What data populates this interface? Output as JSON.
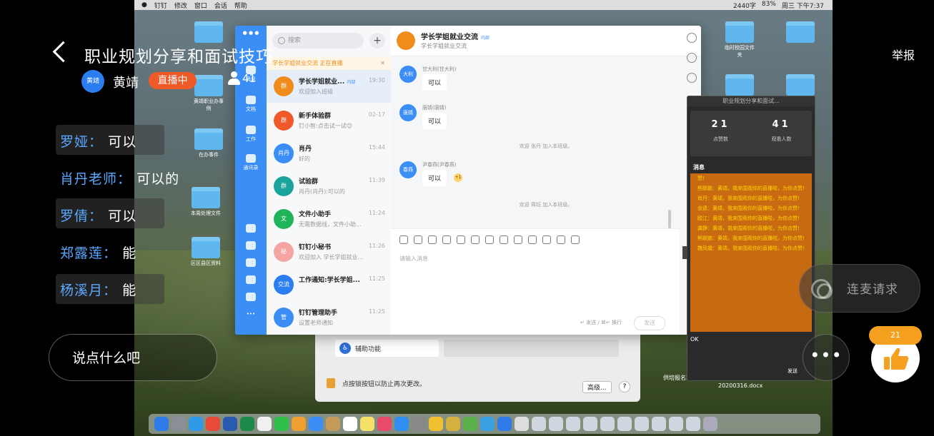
{
  "overlay": {
    "title": "职业规划分享和面试技巧",
    "host_name": "黄靖",
    "host_avatar_text": "黄靖",
    "live_badge": "直播中",
    "viewers": "41",
    "report": "举报",
    "comments": [
      {
        "who": "罗娅",
        "sep": "：",
        "text": "可以"
      },
      {
        "who": "肖丹老师",
        "sep": "：",
        "text": "可以的"
      },
      {
        "who": "罗倩",
        "sep": "：",
        "text": "可以"
      },
      {
        "who": "郑露莲",
        "sep": "：",
        "text": "能"
      },
      {
        "who": "杨溪月",
        "sep": "：",
        "text": "能"
      }
    ],
    "input_placeholder": "说点什么吧",
    "mic_label": "连麦请求",
    "more_label": "•••",
    "like_count": "21"
  },
  "mac": {
    "menus": [
      "钉钉",
      "修改",
      "窗口",
      "会话",
      "帮助"
    ],
    "status_right": [
      "2440字",
      "83%",
      "周三 下午7:37"
    ]
  },
  "desktop": {
    "folders": [
      {
        "label": "黄靖职业办事例"
      },
      {
        "label": "在办事件"
      },
      {
        "label": "本周处理文件"
      },
      {
        "label": "区区县区资料"
      },
      {
        "label": "临时校园文件夹"
      }
    ],
    "files": [
      "供培报名20200316.docx",
      "20200316.docx"
    ]
  },
  "dingtalk": {
    "rail": [
      {
        "label": "消息"
      },
      {
        "label": "文档"
      },
      {
        "label": "工作"
      },
      {
        "label": "通讯录"
      }
    ],
    "search_placeholder": "搜索",
    "live_banner": "学长学姐就业交流 正在直播",
    "conversations": [
      {
        "name": "学长学姐就业...",
        "tag": "内部",
        "preview": "欢迎加入班级",
        "time": "19:30",
        "color": "#f08c1c",
        "av": "群"
      },
      {
        "name": "新手体验群",
        "tag": "",
        "preview": "钉小智:点击试一试😊",
        "time": "02-17",
        "color": "#f05a28",
        "av": "群"
      },
      {
        "name": "肖丹",
        "tag": "",
        "preview": "好的",
        "time": "15:44",
        "color": "#3a8ef6",
        "av": "肖丹"
      },
      {
        "name": "试验群",
        "tag": "",
        "preview": "肖丹(肖丹):可以的",
        "time": "11:39",
        "color": "#1aa39a",
        "av": "群"
      },
      {
        "name": "文件小助手",
        "tag": "",
        "preview": "无需数据线，文件小助...",
        "time": "11:24",
        "color": "#20b45a",
        "av": "文"
      },
      {
        "name": "钉钉小秘书",
        "tag": "",
        "preview": "欢迎加入 学长学姐就业...",
        "time": "11:26",
        "color": "#f5a3a3",
        "av": "秘"
      },
      {
        "name": "工作通知:学长学姐...",
        "tag": "",
        "preview": "",
        "time": "11:25",
        "color": "#2a7ef0",
        "av": "交流"
      },
      {
        "name": "钉钉管理助手",
        "tag": "",
        "preview": "设置老师通知",
        "time": "11:25",
        "color": "#3a8ef6",
        "av": "管"
      }
    ],
    "chat": {
      "title": "学长学姐就业交流",
      "tag": "内部",
      "subtitle": "学长学姐就业交流",
      "messages": [
        {
          "av": "大利",
          "who": "甘大利(甘大利)",
          "text": "可以"
        },
        {
          "av": "唐婧",
          "who": "唐婧(唐婧)",
          "text": "可以"
        },
        {
          "av": "春燕",
          "who": "尹春燕(尹春燕)",
          "text": "可以"
        }
      ],
      "system": [
        "欢迎 张丹 加入本班级。",
        "欢迎 蒋钰 加入本班级。"
      ],
      "input_placeholder": "请输入消息",
      "send_hint": "↵ 发送 / ⌘↵ 换行",
      "send": "发送"
    }
  },
  "live_panel": {
    "title": "职业规划分享和面试...",
    "likes_value": "21",
    "likes_label": "点赞数",
    "viewers_value": "41",
    "viewers_label": "观看人数",
    "messages_header": "消息",
    "feed": [
      "赞!",
      "熊联鹏：黄靖，我来围观你的直播啦，为你点赞!",
      "肖丹：黄靖，我来围观你的直播啦，为你点赞!",
      "余遗：黄靖，我来围观你的直播啦，为你点赞!",
      "欧江：黄靖，我来围观你的直播啦，为你点赞!",
      "龚静：黄靖，我来围观你的直播啦，为你点赞!",
      "熊联鹏：黄靖，我来围观你的直播啦，为你点赞!",
      "魏凤娥：黄靖，我来围观你的直播啦，为你点赞!"
    ],
    "ok": "OK",
    "send": "发送"
  },
  "sysprefs": {
    "assist_label": "辅助功能",
    "lock_text": "点按锁按钮以防止再次更改。",
    "advanced": "高级...",
    "help": "?"
  }
}
